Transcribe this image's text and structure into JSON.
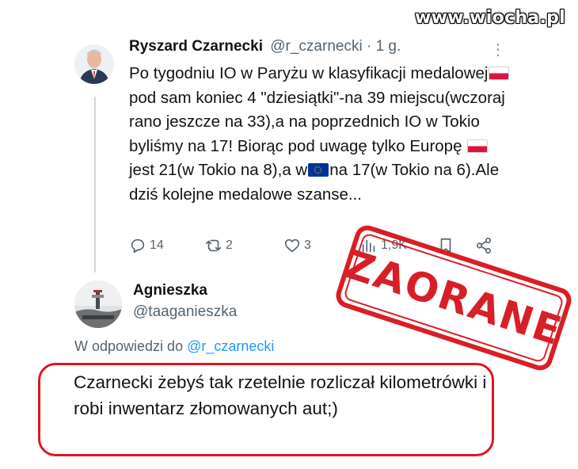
{
  "watermark": "www.wiocha.pl",
  "tweet": {
    "author_name": "Ryszard Czarnecki",
    "author_handle": "@r_czarnecki",
    "separator": " · ",
    "time": "1 g.",
    "text_parts": [
      "Po tygodniu IO w Paryżu w klasyfikacji medalowej",
      "pod sam koniec 4 \"dziesiątki\"-na 39 miejscu(wczoraj rano jeszcze na 33),a na poprzednich IO w Tokio byliśmy na 17! Biorąc pod uwagę tylko Europę ",
      "jest 21(w Tokio na 8),a w",
      "na 17(w Tokio na 6).Ale dziś kolejne medalowe szanse..."
    ],
    "actions": {
      "replies": "14",
      "reposts": "2",
      "likes": "3",
      "views": "1,9K"
    }
  },
  "reply": {
    "author_name": "Agnieszka",
    "author_handle": "@taaganieszka",
    "in_reply_prefix": "W odpowiedzi do ",
    "in_reply_handle": "@r_czarnecki",
    "text": "Czarnecki żebyś tak rzetelnie rozliczał kilometrówki i robi inwentarz złomowanych aut;)"
  },
  "stamp": "ZAORANE",
  "colors": {
    "stamp_red": "#d6141b",
    "highlight_red": "#e0161c",
    "link_blue": "#1d9bf0",
    "muted_gray": "#536471"
  }
}
